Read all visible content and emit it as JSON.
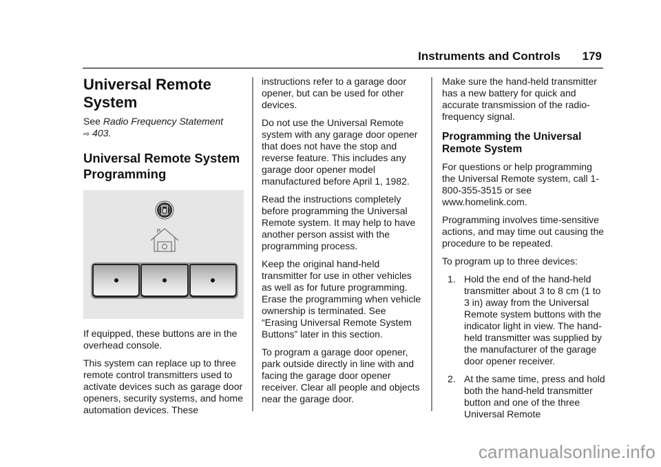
{
  "header": {
    "section_title": "Instruments and Controls",
    "page_number": "179"
  },
  "column1": {
    "title": "Universal Remote System",
    "see_prefix": "See ",
    "see_link": "Radio Frequency Statement",
    "see_arrow": "⇨",
    "see_page": "403",
    "see_suffix": ".",
    "subtitle": "Universal Remote System Programming",
    "figure": {
      "icons": [
        "indicator-light-icon",
        "garage-house-icon"
      ],
      "buttons": [
        "button-1",
        "button-2",
        "button-3"
      ]
    },
    "paragraphs": [
      "If equipped, these buttons are in the overhead console.",
      "This system can replace up to three remote control transmitters used to activate devices such as garage door openers, security systems, and home automation devices. These"
    ]
  },
  "column2": {
    "paragraphs": [
      "instructions refer to a garage door opener, but can be used for other devices.",
      "Do not use the Universal Remote system with any garage door opener that does not have the stop and reverse feature. This includes any garage door opener model manufactured before April 1, 1982.",
      "Read the instructions completely before programming the Universal Remote system. It may help to have another person assist with the programming process.",
      "Keep the original hand-held transmitter for use in other vehicles as well as for future programming. Erase the programming when vehicle ownership is terminated. See “Erasing Universal Remote System Buttons” later in this section.",
      "To program a garage door opener, park outside directly in line with and facing the garage door opener receiver. Clear all people and objects near the garage door."
    ]
  },
  "column3": {
    "intro": "Make sure the hand-held transmitter has a new battery for quick and accurate transmission of the radio-frequency signal.",
    "section_title": "Programming the Universal Remote System",
    "paragraphs": [
      "For questions or help programming the Universal Remote system, call 1-800-355-3515 or see www.homelink.com.",
      "Programming involves time-sensitive actions, and may time out causing the procedure to be repeated.",
      "To program up to three devices:"
    ],
    "steps": [
      {
        "num": "1.",
        "text": "Hold the end of the hand-held transmitter about 3 to 8 cm (1 to 3 in) away from the Universal Remote system buttons with the indicator light in view. The hand-held transmitter was supplied by the manufacturer of the garage door opener receiver."
      },
      {
        "num": "2.",
        "text": "At the same time, press and hold both the hand-held transmitter button and one of the three Universal Remote"
      }
    ]
  },
  "watermark": "carmanualsonline.info"
}
